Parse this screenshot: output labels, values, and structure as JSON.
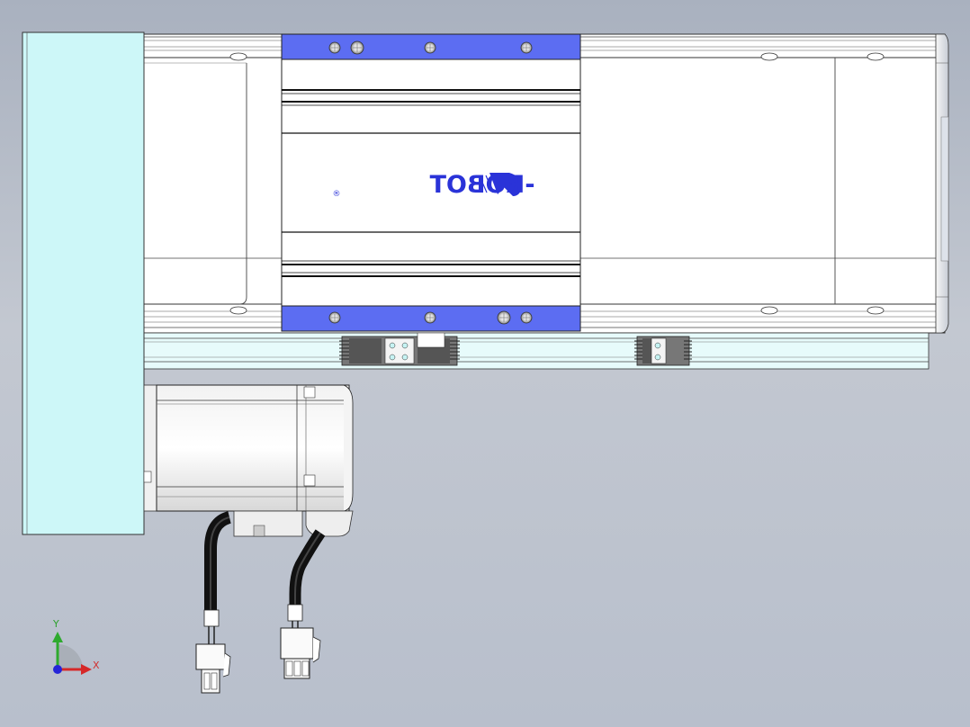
{
  "model": {
    "brand_logo_text": "-ROBOT",
    "registered_mark": "®",
    "colors": {
      "background": "#b9c0cc",
      "end_plate": "#cdf7f8",
      "carriage_plate": "#5c6df2",
      "rail": "#ffffff",
      "rail_channel": "#e7fbfb",
      "logo": "#2a33d8",
      "motor": "#ffffff",
      "cable": "#1a1a1a"
    }
  },
  "triad": {
    "x_label": "X",
    "y_label": "Y",
    "colors": {
      "x": "#d62828",
      "y": "#2eaa2e",
      "z": "#2525d8"
    }
  }
}
